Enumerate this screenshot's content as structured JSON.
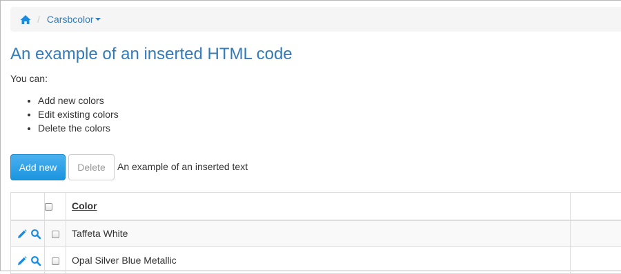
{
  "breadcrumb": {
    "home_icon": "home-icon",
    "separator": "/",
    "current": "Carsbcolor"
  },
  "page": {
    "title": "An example of an inserted HTML code",
    "intro": "You can:",
    "features": [
      "Add new colors",
      "Edit existing colors",
      "Delete the colors"
    ]
  },
  "toolbar": {
    "add_label": "Add new",
    "delete_label": "Delete",
    "inserted_text": "An example of an inserted text"
  },
  "table": {
    "columns": [
      "",
      "",
      "Color",
      ""
    ],
    "rows": [
      {
        "color": "Taffeta White",
        "actions": [
          "pencil-icon",
          "search-icon"
        ]
      },
      {
        "color": "Opal Silver Blue Metallic",
        "actions": [
          "pencil-icon",
          "search-icon"
        ]
      }
    ]
  },
  "colors": {
    "link": "#337ab7",
    "button_primary": "#1b95e0",
    "icon": "#1b8be0"
  }
}
